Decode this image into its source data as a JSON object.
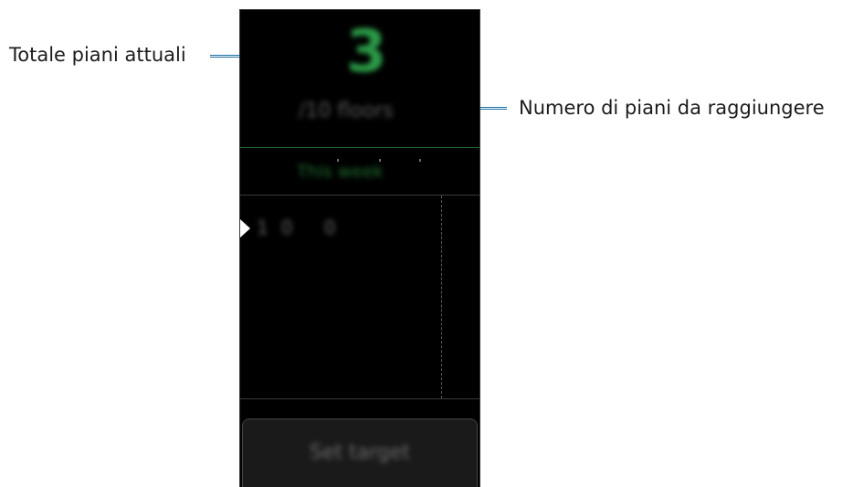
{
  "callouts": {
    "current_total_label": "Totale piani attuali",
    "target_floors_label": "Numero di piani da raggiungere"
  },
  "screen": {
    "floors_count": "3",
    "goal_text": "/10 floors",
    "period_label": "This week",
    "graph_value": "10 0",
    "set_target_button_label": "Set target"
  },
  "colors": {
    "accent_green": "#2a9a46",
    "callout_line": "#1a6fa6",
    "screen_background": "#000000"
  }
}
